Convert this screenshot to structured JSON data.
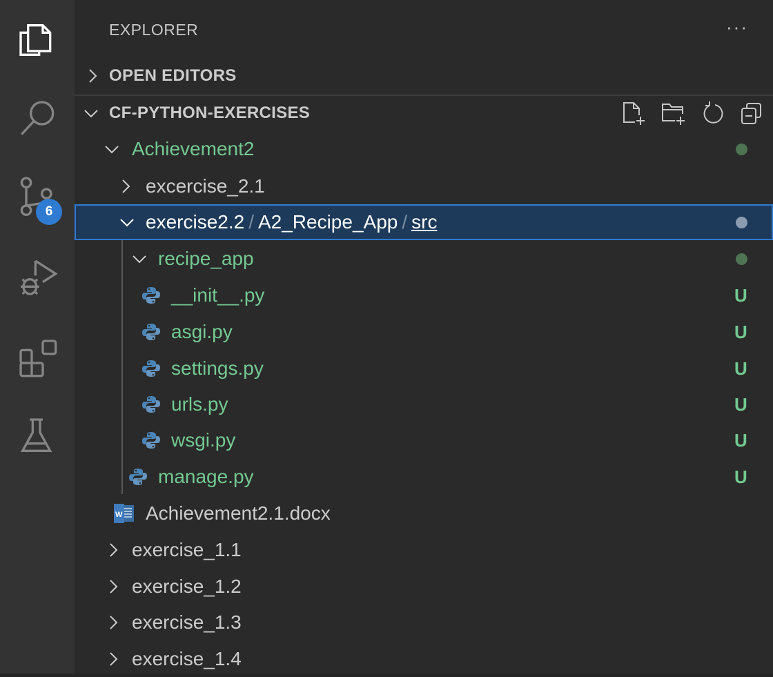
{
  "activity_bar": {
    "items": [
      "explorer",
      "search",
      "source-control",
      "run-debug",
      "extensions",
      "testing"
    ],
    "scm_badge": "6"
  },
  "sidebar": {
    "title": "EXPLORER",
    "more": "···",
    "open_editors": "OPEN EDITORS",
    "workspace": "CF-PYTHON-EXERCISES",
    "tree": {
      "achievement2": "Achievement2",
      "excercise21": "excercise_2.1",
      "selected": {
        "part1": "exercise2.2",
        "sep": "/",
        "part2": "A2_Recipe_App",
        "part3": "src"
      },
      "recipe_app": "recipe_app",
      "files": [
        {
          "name": "__init__.py",
          "status": "U"
        },
        {
          "name": "asgi.py",
          "status": "U"
        },
        {
          "name": "settings.py",
          "status": "U"
        },
        {
          "name": "urls.py",
          "status": "U"
        },
        {
          "name": "wsgi.py",
          "status": "U"
        }
      ],
      "manage": {
        "name": "manage.py",
        "status": "U"
      },
      "docx": "Achievement2.1.docx",
      "exercises": [
        "exercise_1.1",
        "exercise_1.2",
        "exercise_1.3",
        "exercise_1.4"
      ]
    }
  },
  "colors": {
    "untracked": "#73c991",
    "selection": "#1d3a5a",
    "focus": "#2f7bd1",
    "badge": "#2f7bd1"
  }
}
